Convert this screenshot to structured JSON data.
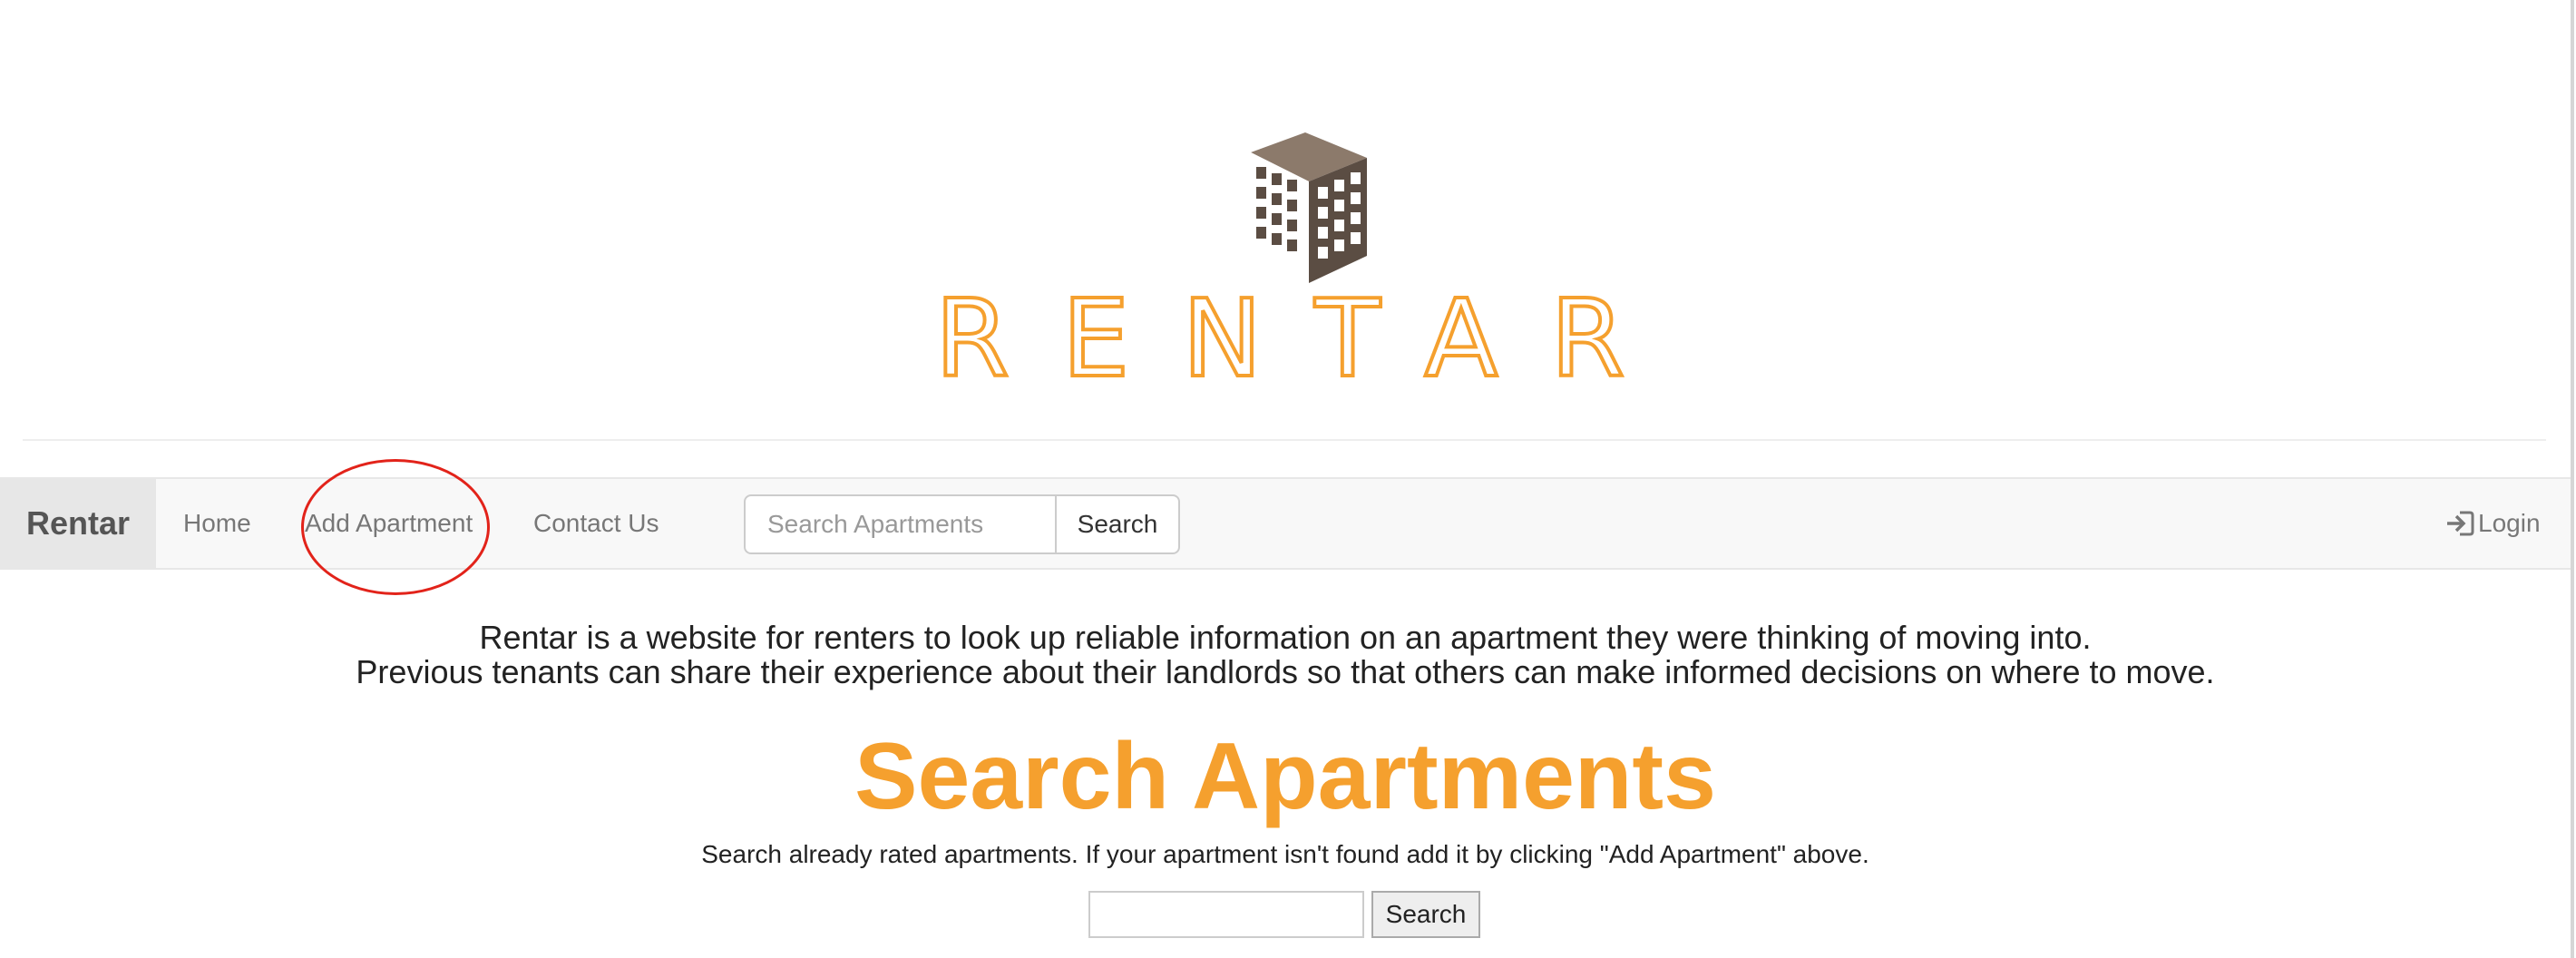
{
  "header": {
    "logo": {
      "icon": "building-icon",
      "wordmark": "RENTAR",
      "colors": {
        "wordmark": "#f5a02e",
        "building": "#5b4d43"
      }
    }
  },
  "navbar": {
    "brand": "Rentar",
    "links": {
      "home": "Home",
      "add_apartment": "Add Apartment",
      "contact": "Contact Us"
    },
    "search": {
      "placeholder": "Search Apartments",
      "value": "",
      "button_label": "Search"
    },
    "login": {
      "label": "Login",
      "icon": "login-icon"
    }
  },
  "main": {
    "intro_line_1": "Rentar is a website for renters to look up reliable information on an apartment they were thinking of moving into.",
    "intro_line_2": "Previous tenants can share their experience about their landlords so that others can make informed decisions on where to move.",
    "title": "Search Apartments",
    "subtitle": "Search already rated apartments. If your apartment isn't found add it by clicking \"Add Apartment\" above.",
    "search": {
      "value": "",
      "button_label": "Search"
    }
  },
  "annotation": {
    "color": "#e2231a",
    "shape": "circle"
  },
  "theme": {
    "accent": "#f5a02e",
    "navbar_bg": "#f8f8f8",
    "brand_bg": "#e7e7e7"
  }
}
